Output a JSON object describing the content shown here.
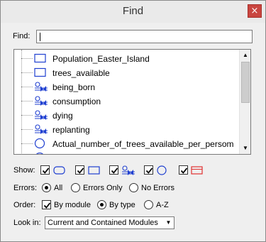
{
  "window": {
    "title": "Find",
    "close_glyph": "×"
  },
  "find": {
    "label": "Find:",
    "value": ""
  },
  "results": [
    {
      "label": "Population_Easter_Island",
      "icon": "stock-rect-icon"
    },
    {
      "label": "trees_available",
      "icon": "stock-rect-icon"
    },
    {
      "label": "being_born",
      "icon": "flow-valve-icon"
    },
    {
      "label": "consumption",
      "icon": "flow-valve-icon"
    },
    {
      "label": "dying",
      "icon": "flow-valve-icon"
    },
    {
      "label": "replanting",
      "icon": "flow-valve-icon"
    },
    {
      "label": "Actual_number_of_trees_available_per_persom",
      "icon": "converter-circle-icon"
    }
  ],
  "show": {
    "label": "Show:",
    "filters": [
      {
        "icon": "rounded-rect-icon",
        "checked": true
      },
      {
        "icon": "rect-icon",
        "checked": true
      },
      {
        "icon": "flow-icon",
        "checked": true
      },
      {
        "icon": "circle-icon",
        "checked": true
      },
      {
        "icon": "red-module-icon",
        "checked": true
      }
    ]
  },
  "errors": {
    "label": "Errors:",
    "options": [
      "All",
      "Errors Only",
      "No Errors"
    ],
    "selected": "All"
  },
  "order": {
    "label": "Order:",
    "by_module_label": "By module",
    "by_module_checked": true,
    "options": [
      "By type",
      "A-Z"
    ],
    "selected": "By type"
  },
  "look_in": {
    "label": "Look in:",
    "value": "Current and Contained Modules"
  },
  "colors": {
    "icon_blue": "#1f3fd0",
    "module_red": "#e03030",
    "close_red": "#c94640"
  }
}
